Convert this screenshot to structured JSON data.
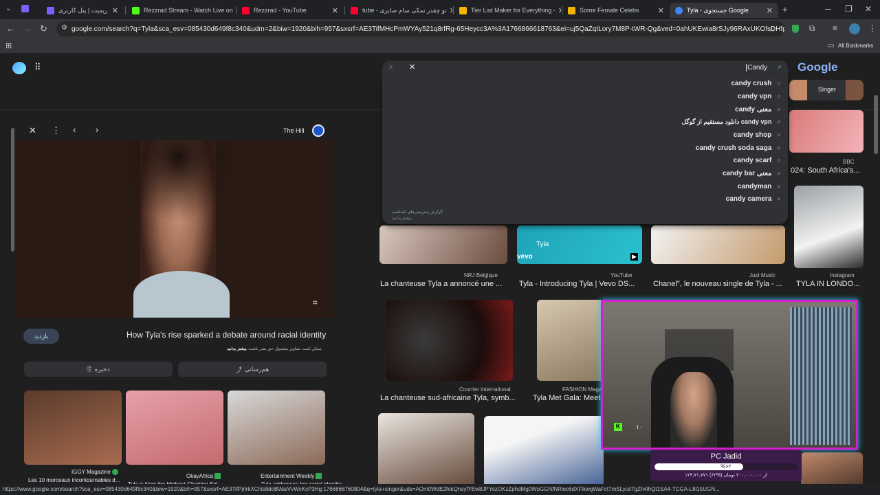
{
  "tabs": [
    {
      "title": "ریمیت | پنل کاربری",
      "color": "#7b61ff"
    },
    {
      "title": "Rezzrad Stream - Watch Live on",
      "color": "#53fc18"
    },
    {
      "title": "Rezzrad - YouTube",
      "color": "#ff0033"
    },
    {
      "title": "tube - تو چقدر تمکی سام صابری",
      "color": "#ff0033"
    },
    {
      "title": "Tier List Maker for Everything -",
      "color": "#f4b400"
    },
    {
      "title": "Some Female Celebs",
      "color": "#f4b400"
    },
    {
      "title": "Tyla - جستجوی Google",
      "color": "#4285f4"
    }
  ],
  "toolbar": {
    "url": "google.com/search?q=Tyla&sca_esv=085430d649f8c340&udm=2&biw=1920&bih=957&sxsrf=AE3TifMHcPmWYAy521q8rfRg-65Heycc3A%3A1766866618763&ei=uj5QaZqtLory7M8P-tWR-Qg&ved=0ahUKEwia8rSJy96RAxUKOfsDHfpqJI8Q4dU...",
    "all_bookmarks": "All Bookmarks"
  },
  "search": {
    "query": "Candy",
    "logo": "Google",
    "singer_chip": "Singer"
  },
  "suggestions": [
    {
      "text": "candy crush"
    },
    {
      "text": "candy vpn"
    },
    {
      "text": "candy معنی"
    },
    {
      "text": "دانلود مستقیم از گوگل candy vpn"
    },
    {
      "text": "candy shop"
    },
    {
      "text": "candy crush soda saga"
    },
    {
      "text": "candy scarf"
    },
    {
      "text": "candy bar معنی"
    },
    {
      "text": "candyman"
    },
    {
      "text": "candy camera"
    }
  ],
  "suggest_footer": [
    "گزارش پیش‌بینی‌های نامناسب",
    "بیشتر بدانید"
  ],
  "panel": {
    "source": "The Hill",
    "headline": "How Tyla's rise sparked a debate around racial identity",
    "visit_button": "بازدید",
    "notice": "ممکن است تصاویر مشمول حق نشر باشند.",
    "notice_link": "بیشتر بدانید",
    "save_button": "ذخیره",
    "share_button": "هم‌رسانی",
    "related": [
      {
        "source": "IGGY Magazine",
        "title": "Les 10 morceaux incontournables d..."
      },
      {
        "source": "OkayAfrica",
        "title": "Tyla is Now the Highest-Charting Sol..."
      },
      {
        "source": "Entertainment Weekly",
        "title": "Tyla addresses her racial identity:"
      }
    ]
  },
  "grid": {
    "top_right": {
      "source": "BBC",
      "title": "024: South Africa's..."
    },
    "row1": [
      {
        "source": "NRJ Belgique",
        "title": "La chanteuse Tyla a annoncé une ..."
      },
      {
        "source": "YouTube",
        "title": "Tyla - Introducing Tyla | Vevo DS..."
      },
      {
        "source": "Just Music",
        "title": "Chanel\", le nouveau single de Tyla - ..."
      },
      {
        "source": "Instagram",
        "title": "TYLA IN LONDO..."
      }
    ],
    "row2": [
      {
        "source": "Courrier international",
        "title": "La chanteuse sud-africaine Tyla, symb..."
      },
      {
        "source": "FASHION Magaz...",
        "title": "Tyla Met Gala: Meet t..."
      }
    ],
    "vevo_label": "vevo",
    "tyla_label": "Tyla"
  },
  "stream": {
    "name": "PC Jadid",
    "progress_percent": 62,
    "progress_label": "%۶۲",
    "donation_text": "۱۲۴,۷۱,۷۷۱ از ۲۰۰,۰۰۰,۰۰۰ تومان (%۶۲)",
    "badge": "۱۰"
  },
  "status_url": "https://www.google.com/search?sca_esv=085430d649f8c340&biw=1920&bih=957&sxsrf=AE3TifPjrlrkXChls8doBWaiVvWcKcP3Hg:1766866760804&q=tyla+singer&uds=AOm0WdE2fekQnsyfYEw8JPYozOKzZphdMg0WoGGNfNRiec6dXFlkwgWaFct7mSLyuit7gZh4lhQt1SA4-TCGA-L8l15UGN..."
}
